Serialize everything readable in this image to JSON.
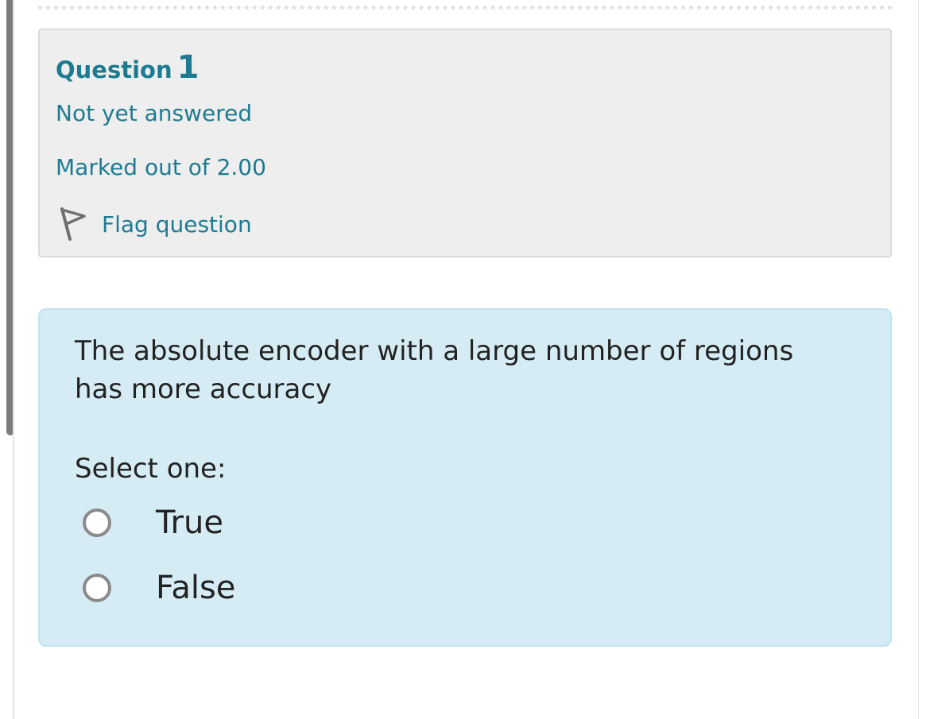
{
  "question_info": {
    "label": "Question",
    "number": "1",
    "state": "Not yet answered",
    "grade": "Marked out of 2.00",
    "flag_label": "Flag question",
    "flag_icon": "flag-icon"
  },
  "question": {
    "text": "The absolute encoder with a large number of regions has more accuracy",
    "prompt": "Select one:",
    "options": [
      {
        "label": "True",
        "selected": false
      },
      {
        "label": "False",
        "selected": false
      }
    ]
  },
  "colors": {
    "link_blue": "#1d7b91",
    "info_background": "#eeeeee",
    "formulation_background": "#d6ecf5",
    "formulation_border": "#bfe3f0",
    "text": "#222222"
  }
}
